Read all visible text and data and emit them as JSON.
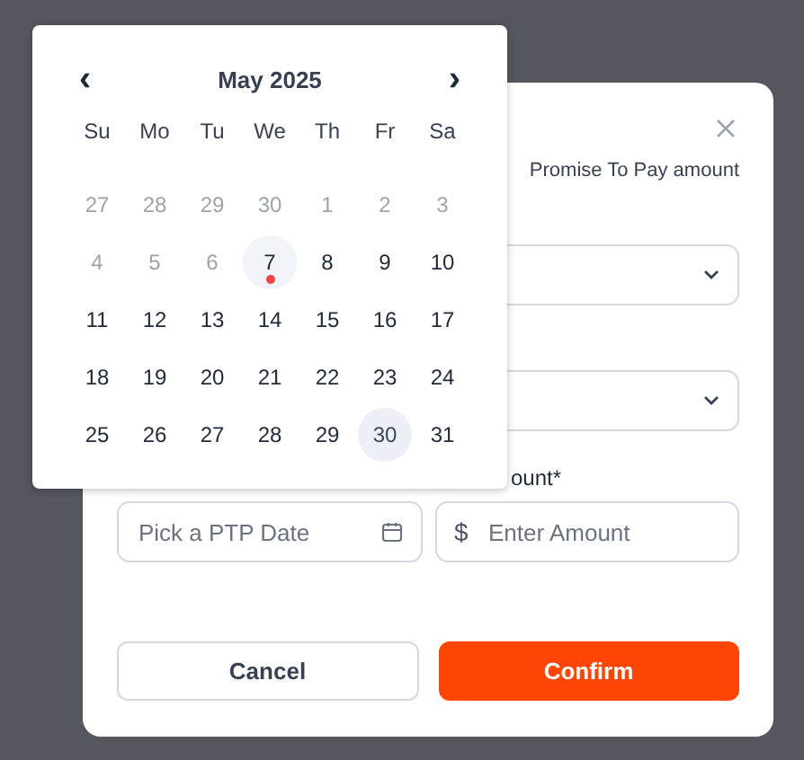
{
  "calendar": {
    "month": "May 2025",
    "prev": "‹",
    "next": "›",
    "weekdays": [
      "Su",
      "Mo",
      "Tu",
      "We",
      "Th",
      "Fr",
      "Sa"
    ],
    "days": [
      {
        "label": "27",
        "outside": true,
        "selected": false,
        "today": false
      },
      {
        "label": "28",
        "outside": true,
        "selected": false,
        "today": false
      },
      {
        "label": "29",
        "outside": true,
        "selected": false,
        "today": false
      },
      {
        "label": "30",
        "outside": true,
        "selected": false,
        "today": false
      },
      {
        "label": "1",
        "outside": true,
        "selected": false,
        "today": false
      },
      {
        "label": "2",
        "outside": true,
        "selected": false,
        "today": false
      },
      {
        "label": "3",
        "outside": true,
        "selected": false,
        "today": false
      },
      {
        "label": "4",
        "outside": true,
        "selected": false,
        "today": false
      },
      {
        "label": "5",
        "outside": true,
        "selected": false,
        "today": false
      },
      {
        "label": "6",
        "outside": true,
        "selected": false,
        "today": false
      },
      {
        "label": "7",
        "outside": false,
        "selected": false,
        "today": true
      },
      {
        "label": "8",
        "outside": false,
        "selected": false,
        "today": false
      },
      {
        "label": "9",
        "outside": false,
        "selected": false,
        "today": false
      },
      {
        "label": "10",
        "outside": false,
        "selected": false,
        "today": false
      },
      {
        "label": "11",
        "outside": false,
        "selected": false,
        "today": false
      },
      {
        "label": "12",
        "outside": false,
        "selected": false,
        "today": false
      },
      {
        "label": "13",
        "outside": false,
        "selected": false,
        "today": false
      },
      {
        "label": "14",
        "outside": false,
        "selected": false,
        "today": false
      },
      {
        "label": "15",
        "outside": false,
        "selected": false,
        "today": false
      },
      {
        "label": "16",
        "outside": false,
        "selected": false,
        "today": false
      },
      {
        "label": "17",
        "outside": false,
        "selected": false,
        "today": false
      },
      {
        "label": "18",
        "outside": false,
        "selected": false,
        "today": false
      },
      {
        "label": "19",
        "outside": false,
        "selected": false,
        "today": false
      },
      {
        "label": "20",
        "outside": false,
        "selected": false,
        "today": false
      },
      {
        "label": "21",
        "outside": false,
        "selected": false,
        "today": false
      },
      {
        "label": "22",
        "outside": false,
        "selected": false,
        "today": false
      },
      {
        "label": "23",
        "outside": false,
        "selected": false,
        "today": false
      },
      {
        "label": "24",
        "outside": false,
        "selected": false,
        "today": false
      },
      {
        "label": "25",
        "outside": false,
        "selected": false,
        "today": false
      },
      {
        "label": "26",
        "outside": false,
        "selected": false,
        "today": false
      },
      {
        "label": "27",
        "outside": false,
        "selected": false,
        "today": false
      },
      {
        "label": "28",
        "outside": false,
        "selected": false,
        "today": false
      },
      {
        "label": "29",
        "outside": false,
        "selected": false,
        "today": false
      },
      {
        "label": "30",
        "outside": false,
        "selected": true,
        "today": false
      },
      {
        "label": "31",
        "outside": false,
        "selected": false,
        "today": false
      }
    ]
  },
  "dialog": {
    "subtitle": "Promise To Pay amount",
    "amount_label": "ount*",
    "date_field": {
      "placeholder": "Pick a PTP Date"
    },
    "amount_field": {
      "prefix": "$",
      "placeholder": "Enter Amount"
    },
    "buttons": [
      {
        "label": "Cancel",
        "kind": "secondary"
      },
      {
        "label": "Confirm",
        "kind": "primary"
      }
    ]
  }
}
